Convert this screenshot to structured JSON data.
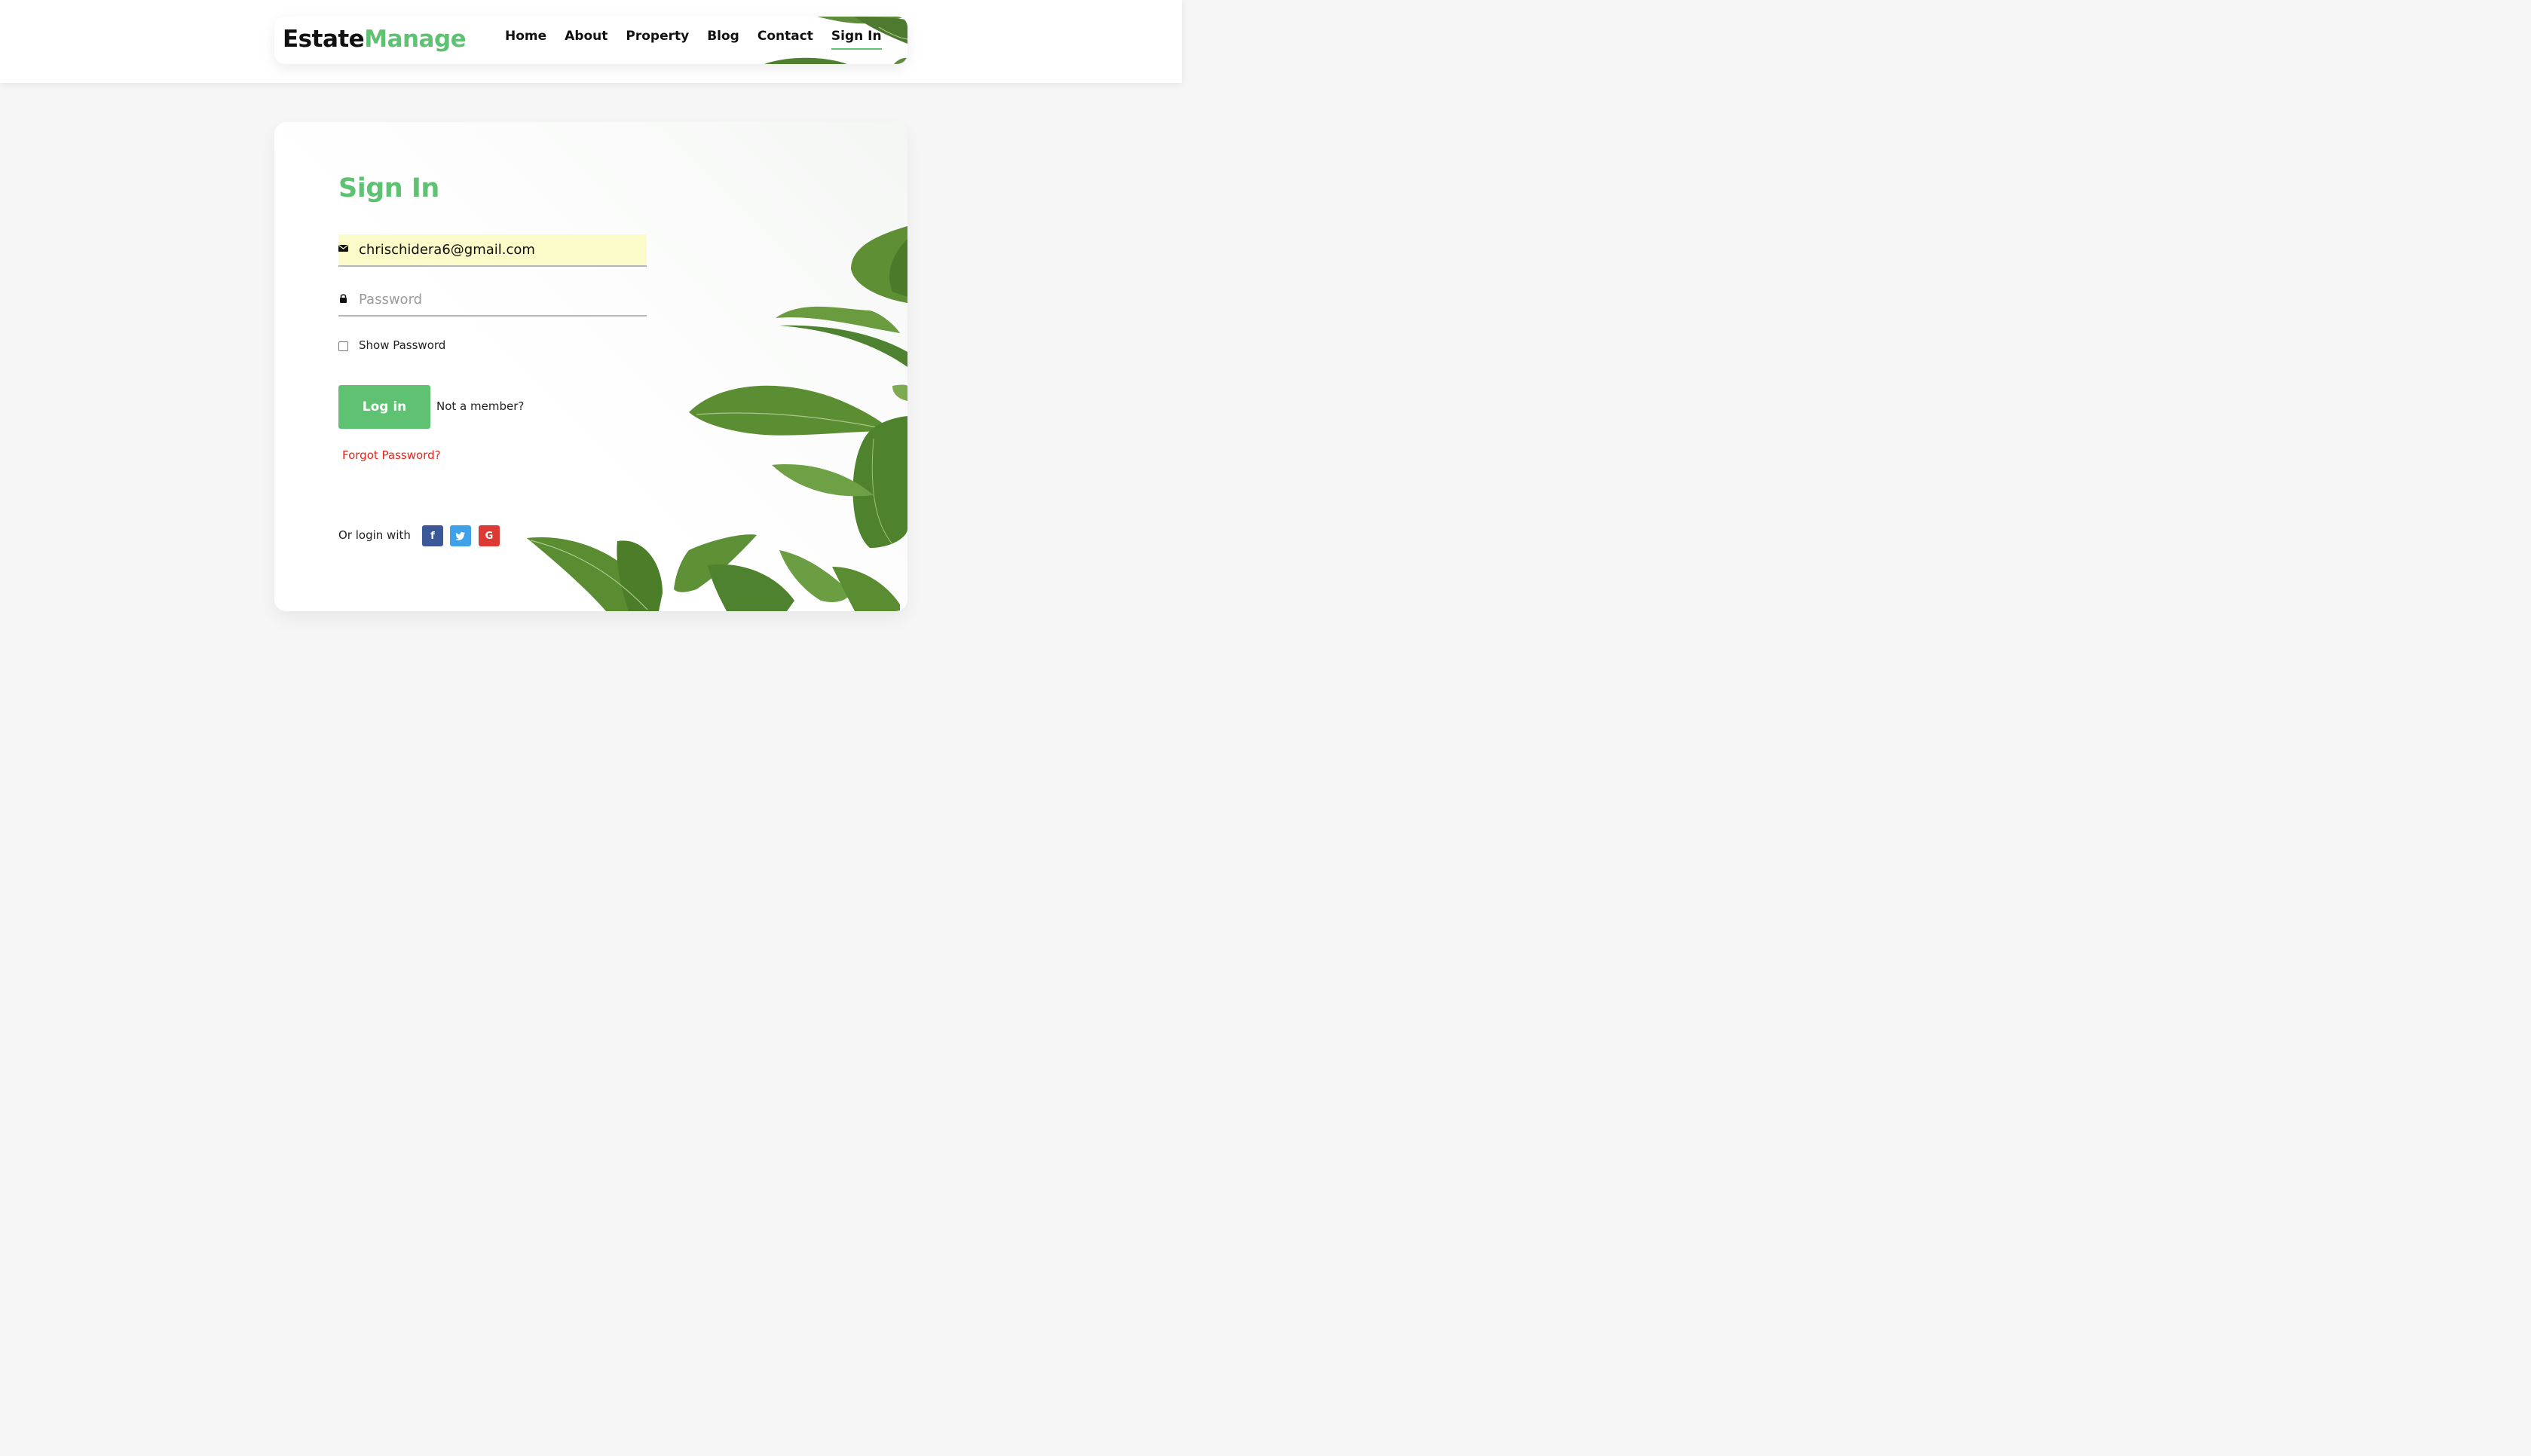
{
  "header": {
    "brand_part1": "Estate",
    "brand_part2": "Manage",
    "nav": [
      {
        "label": "Home"
      },
      {
        "label": "About"
      },
      {
        "label": "Property"
      },
      {
        "label": "Blog"
      },
      {
        "label": "Contact"
      },
      {
        "label": "Sign In",
        "active": true
      }
    ]
  },
  "form": {
    "title": "Sign In",
    "email": {
      "value": "chrischidera6@gmail.com",
      "icon": "envelope-icon"
    },
    "password": {
      "placeholder": "Password",
      "value": "",
      "icon": "lock-icon"
    },
    "show_password_label": "Show Password",
    "login_button": "Log in",
    "not_member": "Not a member?",
    "forgot_password": "Forgot Password?",
    "or_login_with": "Or login with",
    "social": [
      {
        "name": "facebook",
        "glyph": "f",
        "color": "#3b5998"
      },
      {
        "name": "twitter",
        "glyph": "t",
        "color": "#3fa1e8"
      },
      {
        "name": "google",
        "glyph": "G",
        "color": "#dc3a34"
      }
    ]
  },
  "colors": {
    "accent": "#5ec272",
    "forgot_link": "#e3261c",
    "email_autofill_bg": "#fafbc8",
    "page_bg": "#f6f6f6"
  }
}
